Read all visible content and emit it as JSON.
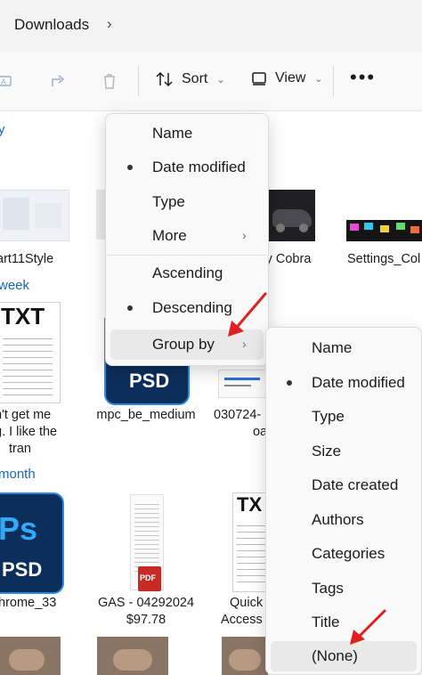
{
  "address": {
    "breadcrumb": "Downloads",
    "chevron": "›"
  },
  "toolbar": {
    "sort_label": "Sort",
    "view_label": "View",
    "more_label": "•••"
  },
  "content": {
    "group_headers": [
      "y",
      "week",
      "month"
    ],
    "files": {
      "art11style": "art11Style",
      "cobra": "y Cobra",
      "settings": "Settings_Col",
      "txt_left_line1": "n't get me",
      "txt_left_line2": "g. I like the",
      "txt_left_line3": "tran",
      "mpc": "mpc_be_medium",
      "num_line1": "030724-",
      "num_line2": "oa",
      "chrome": "hrome_33",
      "gas_line1": "GAS - 04292024",
      "gas_line2": "$97.78",
      "quick_line1": "Quick",
      "quick_line2": "Access C"
    },
    "thumb_text": {
      "txt": "TXT",
      "psd": "PSD",
      "ps": "Ps",
      "pdf": "PDF",
      "txt_small": "TX"
    }
  },
  "sort_menu": {
    "items": [
      {
        "label": "Name",
        "selected": false
      },
      {
        "label": "Date modified",
        "selected": true
      },
      {
        "label": "Type",
        "selected": false
      },
      {
        "label": "More",
        "selected": false,
        "submenu": true
      }
    ],
    "order": [
      {
        "label": "Ascending",
        "selected": false
      },
      {
        "label": "Descending",
        "selected": true
      }
    ],
    "group_by": {
      "label": "Group by",
      "submenu": true
    }
  },
  "groupby_menu": {
    "items": [
      {
        "label": "Name",
        "selected": false
      },
      {
        "label": "Date modified",
        "selected": true
      },
      {
        "label": "Type",
        "selected": false
      },
      {
        "label": "Size",
        "selected": false
      },
      {
        "label": "Date created",
        "selected": false
      },
      {
        "label": "Authors",
        "selected": false
      },
      {
        "label": "Categories",
        "selected": false
      },
      {
        "label": "Tags",
        "selected": false
      },
      {
        "label": "Title",
        "selected": false
      },
      {
        "label": "(None)",
        "selected": false
      }
    ]
  },
  "colors": {
    "accent": "#1a64b8",
    "annotation_arrow": "#e02020",
    "psd_blue": "#0b2e5a"
  }
}
